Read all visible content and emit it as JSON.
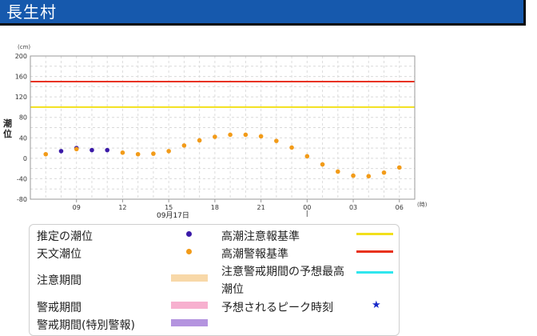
{
  "page": {
    "title": "長生村"
  },
  "chart_data": {
    "type": "scatter",
    "ylabel": "潮位",
    "yunit": "(cm)",
    "xunit": "(時)",
    "date_label": "09月17日",
    "ylim": [
      -80,
      200
    ],
    "yticks": [
      -80,
      -40,
      0,
      40,
      80,
      120,
      160,
      200
    ],
    "ygrid": [
      -80,
      -60,
      -40,
      -20,
      0,
      20,
      40,
      60,
      80,
      100,
      120,
      140,
      160,
      180,
      200
    ],
    "xrange": [
      6,
      31
    ],
    "xticks": [
      {
        "x": 9,
        "label": "09"
      },
      {
        "x": 12,
        "label": "12"
      },
      {
        "x": 15,
        "label": "15"
      },
      {
        "x": 18,
        "label": "18"
      },
      {
        "x": 21,
        "label": "21"
      },
      {
        "x": 24,
        "label": "00"
      },
      {
        "x": 27,
        "label": "03"
      },
      {
        "x": 30,
        "label": "06"
      }
    ],
    "day_marker_x": 24,
    "grid": true,
    "thresholds": [
      {
        "name": "高潮警報基準",
        "value": 150,
        "color": "#e8321c"
      },
      {
        "name": "高潮注意報基準",
        "value": 100,
        "color": "#f2e01b"
      }
    ],
    "series": [
      {
        "name": "推定の潮位",
        "color": "#3b1aa8",
        "x": [
          8,
          9,
          10,
          11
        ],
        "y": [
          14,
          20,
          16,
          16
        ]
      },
      {
        "name": "天文潮位",
        "color": "#f29b19",
        "x": [
          7,
          9,
          12,
          13,
          14,
          15,
          16,
          17,
          18,
          19,
          20,
          21,
          22,
          23,
          24,
          25,
          26,
          27,
          28,
          29,
          30
        ],
        "y": [
          8,
          18,
          11,
          8,
          9,
          14,
          25,
          35,
          42,
          46,
          46,
          43,
          34,
          21,
          4,
          -12,
          -26,
          -34,
          -35,
          -28,
          -18
        ]
      }
    ]
  },
  "legend": {
    "items": [
      {
        "label": "推定の潮位",
        "kind": "dot",
        "color": "#3b1aa8"
      },
      {
        "label": "天文潮位",
        "kind": "dot",
        "color": "#f29b19"
      },
      {
        "label": "注意期間",
        "kind": "bar",
        "color": "#f8d8a8"
      },
      {
        "label": "警戒期間",
        "kind": "bar",
        "color": "#f7b0cf"
      },
      {
        "label": "警戒期間(特別警報)",
        "kind": "bar",
        "color": "#b494df"
      },
      {
        "label": "高潮注意報基準",
        "kind": "line",
        "color": "#f2e01b"
      },
      {
        "label": "高潮警報基準",
        "kind": "line",
        "color": "#e8321c"
      },
      {
        "label": "注意警戒期間の予想最高潮位",
        "kind": "line",
        "color": "#2fe6ee"
      },
      {
        "label": "予想されるピーク時刻",
        "kind": "star",
        "color": "#1628c9",
        "symbol": "★"
      }
    ]
  }
}
